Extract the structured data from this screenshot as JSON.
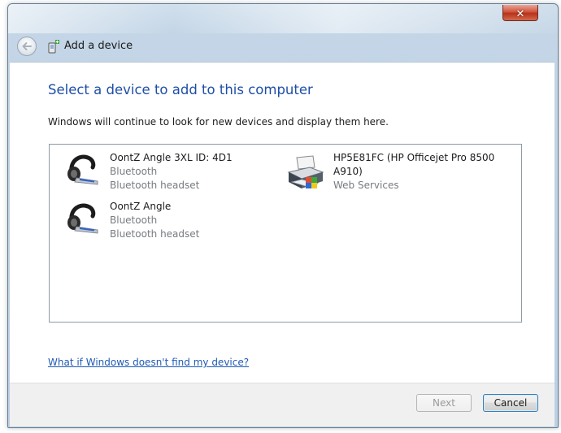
{
  "window": {
    "title": "Add a device",
    "close_label": "✕"
  },
  "content": {
    "heading": "Select a device to add to this computer",
    "subtext": "Windows will continue to look for new devices and display them here."
  },
  "devices": [
    {
      "name": "OontZ Angle 3XL ID: 4D1",
      "line1": "Bluetooth",
      "line2": "Bluetooth headset",
      "icon": "bluetooth-headset-icon"
    },
    {
      "name": "OontZ Angle",
      "line1": "Bluetooth",
      "line2": "Bluetooth headset",
      "icon": "bluetooth-headset-icon"
    },
    {
      "name_line1": "HP5E81FC (HP Officejet Pro 8500",
      "name_line2": "A910)",
      "line1": "Web Services",
      "icon": "printer-icon"
    }
  ],
  "help_link": "What if Windows doesn't find my device?",
  "buttons": {
    "next": "Next",
    "cancel": "Cancel"
  },
  "colors": {
    "heading": "#1e4ea8",
    "link": "#1f5ab4",
    "secondary_text": "#777b80",
    "close_button": "#c8452c"
  }
}
